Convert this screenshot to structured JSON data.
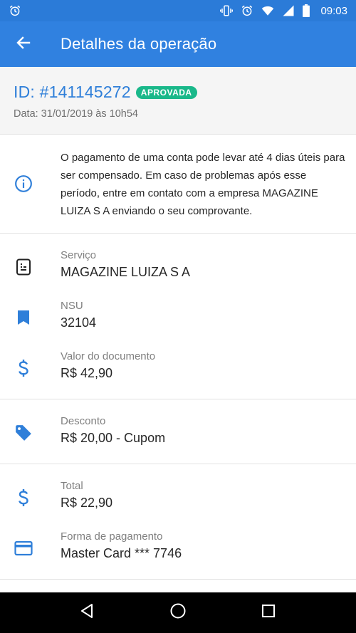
{
  "status_bar": {
    "time": "09:03",
    "icons": [
      "alarm-icon",
      "vibrate-icon",
      "alarm-icon",
      "wifi-icon",
      "signal-icon",
      "battery-icon"
    ]
  },
  "app_bar": {
    "title": "Detalhes da operação",
    "back_icon": "arrow-back-icon"
  },
  "operation": {
    "id": "ID: #141145272",
    "status": "APROVADA",
    "date": "Data: 31/01/2019 às 10h54"
  },
  "info": {
    "icon": "info-icon",
    "text": "O pagamento de uma conta pode levar até 4 dias úteis para ser compensado. Em caso de problemas após esse período, entre em contato com a empresa MAGAZINE LUIZA S A enviando o seu comprovante."
  },
  "fields": {
    "servico": {
      "label": "Serviço",
      "value": "MAGAZINE LUIZA S A",
      "icon": "receipt-icon"
    },
    "nsu": {
      "label": "NSU",
      "value": "32104",
      "icon": "bookmark-icon"
    },
    "valor": {
      "label": "Valor do documento",
      "value": "R$ 42,90",
      "icon": "dollar-icon"
    },
    "desconto": {
      "label": "Desconto",
      "value": "R$ 20,00 - Cupom",
      "icon": "tag-icon"
    },
    "total": {
      "label": "Total",
      "value": "R$ 22,90",
      "icon": "dollar-icon"
    },
    "forma": {
      "label": "Forma de pagamento",
      "value": "Master Card *** 7746",
      "icon": "credit-card-icon"
    }
  },
  "colors": {
    "primary": "#3081e0",
    "status_bar": "#2b7bd8",
    "id_text": "#2f7fd9",
    "badge": "#1ab88a",
    "icon": "#2f7fd9"
  },
  "nav_bar": {
    "buttons": [
      "back-triangle-icon",
      "home-circle-icon",
      "recents-square-icon"
    ]
  }
}
